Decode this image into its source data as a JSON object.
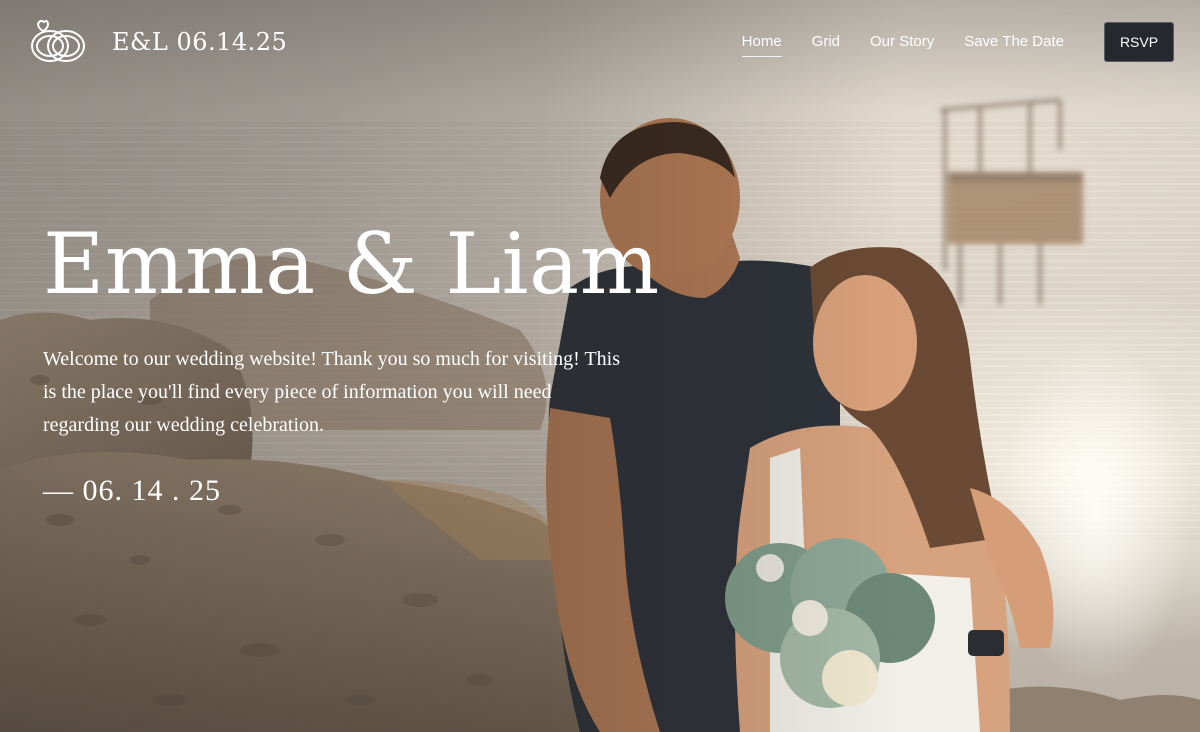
{
  "nav": {
    "brand": "E&L 06.14.25",
    "links": [
      {
        "label": "Home",
        "active": true
      },
      {
        "label": "Grid",
        "active": false
      },
      {
        "label": "Our Story",
        "active": false
      },
      {
        "label": "Save The Date",
        "active": false
      }
    ],
    "rsvp_label": "RSVP",
    "logo_icon": "linked-rings-logo-icon"
  },
  "hero": {
    "title": "Emma & Liam",
    "intro": "Welcome to our wedding website! Thank you so much for visiting! This is the place you'll find every piece of information you will need regarding our wedding celebration.",
    "date": "— 06. 14 . 25"
  },
  "colors": {
    "text": "#ffffff",
    "rsvp_bg": "#25292d",
    "sea_light": "#d6cec3",
    "rock": "#8f806f"
  }
}
